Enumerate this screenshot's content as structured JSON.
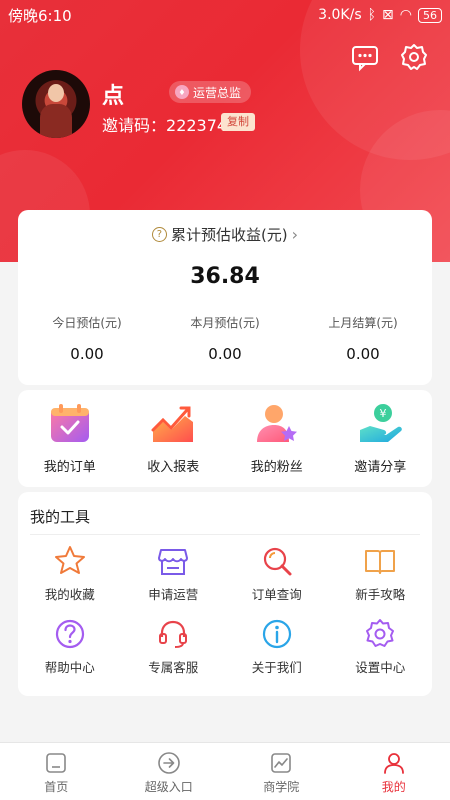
{
  "status_bar": {
    "time": "傍晚6:10",
    "network_speed": "3.0K/s",
    "battery": "56"
  },
  "profile": {
    "name": "点",
    "role": "运营总监",
    "invite_label": "邀请码：",
    "invite_code": "222374",
    "copy_label": "复制"
  },
  "earnings": {
    "title": "累计预估收益(元)",
    "total": "36.84",
    "stats": [
      {
        "label": "今日预估(元)",
        "value": "0.00"
      },
      {
        "label": "本月预估(元)",
        "value": "0.00"
      },
      {
        "label": "上月结算(元)",
        "value": "0.00"
      }
    ]
  },
  "shortcuts": [
    {
      "label": "我的订单",
      "icon": "calendar-check-icon"
    },
    {
      "label": "收入报表",
      "icon": "chart-up-icon"
    },
    {
      "label": "我的粉丝",
      "icon": "user-star-icon"
    },
    {
      "label": "邀请分享",
      "icon": "hand-coin-icon"
    }
  ],
  "tools": {
    "title": "我的工具",
    "items": [
      {
        "label": "我的收藏",
        "icon": "star-icon"
      },
      {
        "label": "申请运营",
        "icon": "store-icon"
      },
      {
        "label": "订单查询",
        "icon": "search-icon"
      },
      {
        "label": "新手攻略",
        "icon": "book-icon"
      },
      {
        "label": "帮助中心",
        "icon": "question-icon"
      },
      {
        "label": "专属客服",
        "icon": "headset-icon"
      },
      {
        "label": "关于我们",
        "icon": "info-icon"
      },
      {
        "label": "设置中心",
        "icon": "gear-icon"
      }
    ]
  },
  "tabbar": [
    {
      "label": "首页",
      "icon": "home-icon",
      "active": false
    },
    {
      "label": "超级入口",
      "icon": "enter-icon",
      "active": false
    },
    {
      "label": "商学院",
      "icon": "trend-icon",
      "active": false
    },
    {
      "label": "我的",
      "icon": "user-icon",
      "active": true
    }
  ],
  "colors": {
    "brand": "#e8303a",
    "copy_bg": "#fce3cf"
  }
}
